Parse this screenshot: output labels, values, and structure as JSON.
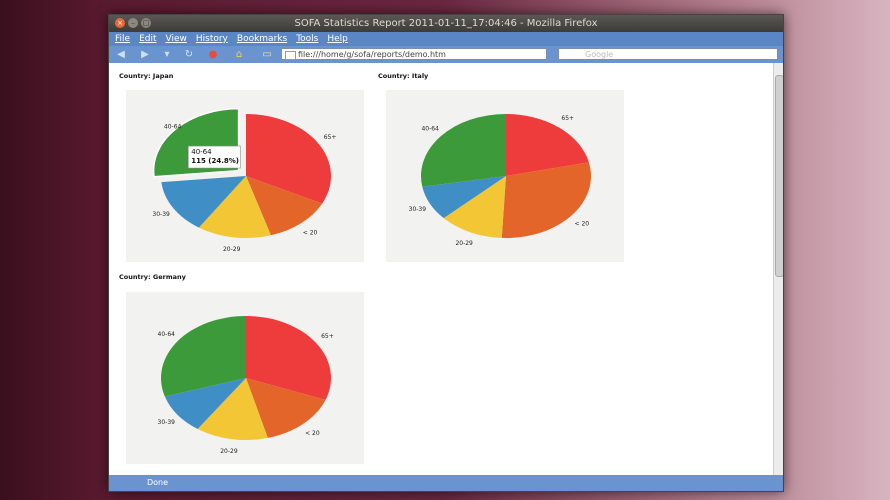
{
  "window": {
    "title": "SOFA Statistics Report 2011-01-11_17:04:46 - Mozilla Firefox"
  },
  "menu": [
    "File",
    "Edit",
    "View",
    "History",
    "Bookmarks",
    "Tools",
    "Help"
  ],
  "url": "file:///home/g/sofa/reports/demo.htm",
  "search_placeholder": "Google",
  "status": "Done",
  "colors": {
    "65+": "#ee3b3b",
    "< 20": "#e3652a",
    "20-29": "#f2c634",
    "30-39": "#3f8fc6",
    "40-64": "#3c9a3a"
  },
  "chart_data": [
    {
      "type": "pie",
      "title": "Country: Japan",
      "categories": [
        "65+",
        "< 20",
        "20-29",
        "30-39",
        "40-64"
      ],
      "values": [
        140,
        56,
        61,
        61,
        115
      ],
      "tooltip": {
        "category": "40-64",
        "label": "40-64",
        "value_text": "115 (24.8%)"
      }
    },
    {
      "type": "pie",
      "title": "Country: Italy",
      "categories": [
        "65+",
        "< 20",
        "20-29",
        "30-39",
        "40-64"
      ],
      "values": [
        108,
        148,
        62,
        46,
        140
      ]
    },
    {
      "type": "pie",
      "title": "Country: Germany",
      "categories": [
        "65+",
        "< 20",
        "20-29",
        "30-39",
        "40-64"
      ],
      "values": [
        134,
        66,
        60,
        46,
        130
      ]
    }
  ]
}
